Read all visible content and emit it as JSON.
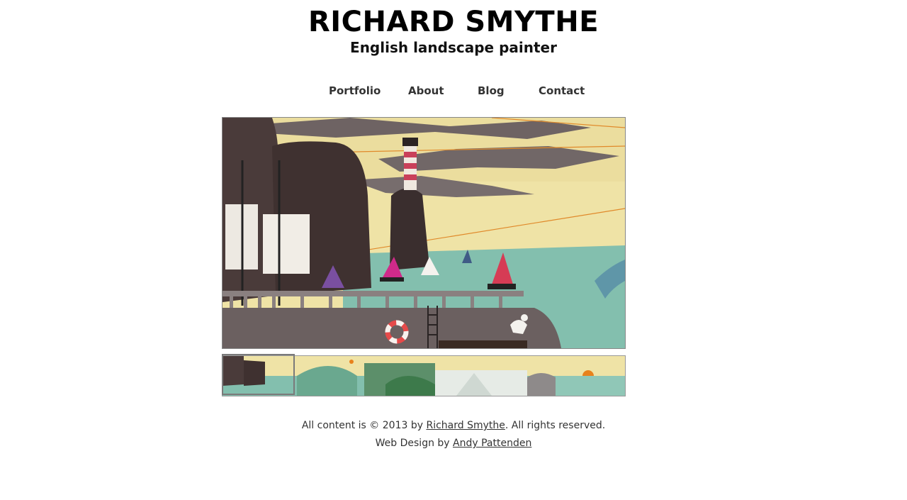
{
  "header": {
    "title": "RICHARD SMYTHE",
    "subtitle": "English landscape painter"
  },
  "nav": {
    "items": [
      "Portfolio",
      "About",
      "Blog",
      "Contact"
    ]
  },
  "gallery": {
    "main_image_icon": "landscape-painting-harbour-lighthouse",
    "filmstrip_icon": "panorama-painting-strip"
  },
  "footer": {
    "line1_prefix": "All content is © 2013 by ",
    "line1_link": "Richard Smythe",
    "line1_suffix": ". All rights reserved.",
    "line2_prefix": "Web Design by ",
    "line2_link": "Andy Pattenden"
  },
  "colors": {
    "sky": "#efe3a6",
    "sea": "#83bfae",
    "rock": "#4a3b3a",
    "quay": "#6b6060",
    "accent_red": "#d63c55"
  }
}
